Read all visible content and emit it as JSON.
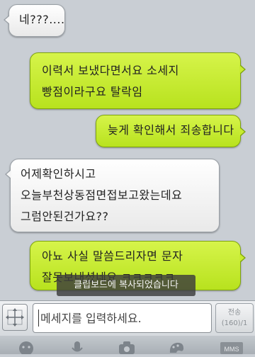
{
  "messages": [
    {
      "direction": "in",
      "lines": [
        "네???...."
      ]
    },
    {
      "direction": "out",
      "lines": [
        "이력서 보냈다면서요 소세지",
        "빵점이라구요 탈락임"
      ]
    },
    {
      "direction": "out",
      "lines": [
        "늦게 확인해서 죄송합니다"
      ]
    },
    {
      "direction": "in",
      "lines": [
        "어제확인하시고",
        "오늘부천상동점면접보고왔는데요",
        "그럼안된건가요??"
      ]
    },
    {
      "direction": "out",
      "lines": [
        "아뇨 사실 말씀드리자면 문자",
        "잘못보내셨네요 ㅋㅋㅋㅋㅋ"
      ]
    }
  ],
  "toast": "클립보드에 복사되었습니다",
  "composer": {
    "placeholder": "메세지를 입력하세요.",
    "send_label": "전송",
    "char_count": "(160)/1"
  },
  "toolbar": {
    "icons": [
      "emoticon-icon",
      "microphone-icon",
      "camera-icon",
      "paint-icon",
      "mms-icon"
    ],
    "mms_label": "MMS"
  },
  "colors": {
    "incoming_bubble": "#f4f4f4",
    "outgoing_bubble": "#c8ec30",
    "background": "#c9ced4"
  }
}
